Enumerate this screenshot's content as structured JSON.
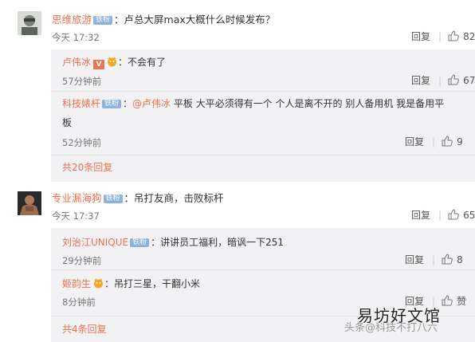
{
  "threads": [
    {
      "user": "思维旅游",
      "badge": "铁粉",
      "text": "：卢总大屏max大概什么时候发布？",
      "time": "今天 17:32",
      "reply_label": "回复",
      "likes": "82",
      "subs": [
        {
          "user": "卢伟冰",
          "badge_v": "V",
          "text": "：不会有了",
          "time": "57分钟前",
          "reply_label": "回复",
          "likes": "67"
        },
        {
          "user": "科技婊杆",
          "badge": "铁粉",
          "mention": "@卢伟冰",
          "text_line1": "：",
          "text_after": " 平板 大平必须得有一个  个人是离不开的  别人备用机  我是备用平",
          "text_line2": "板",
          "time": "52分钟前",
          "reply_label": "回复",
          "likes": "9"
        }
      ],
      "more": "共20条回复"
    },
    {
      "user": "专业漏海狗",
      "badge": "铁粉",
      "text": "：吊打友商，击败标杆",
      "time": "今天 17:37",
      "reply_label": "回复",
      "likes": "65",
      "subs": [
        {
          "user": "刘治江UNIQUE",
          "badge": "铁粉",
          "text": "：讲讲员工福利，暗讽一下251",
          "time": "29分钟前",
          "reply_label": "回复",
          "likes": "8"
        },
        {
          "user": "姬韵生",
          "text": "：吊打三星，干翻小米",
          "time": "8分钟前",
          "reply_label": "回复",
          "likes": "赞"
        }
      ],
      "more": "共4条回复"
    }
  ],
  "watermark": {
    "source": "头条@科技不打八六",
    "brand": "易坊好文馆"
  },
  "colors": {
    "username": "#eb7350",
    "badge": "#8cb3dd",
    "subbox": "#f2f2f5"
  }
}
